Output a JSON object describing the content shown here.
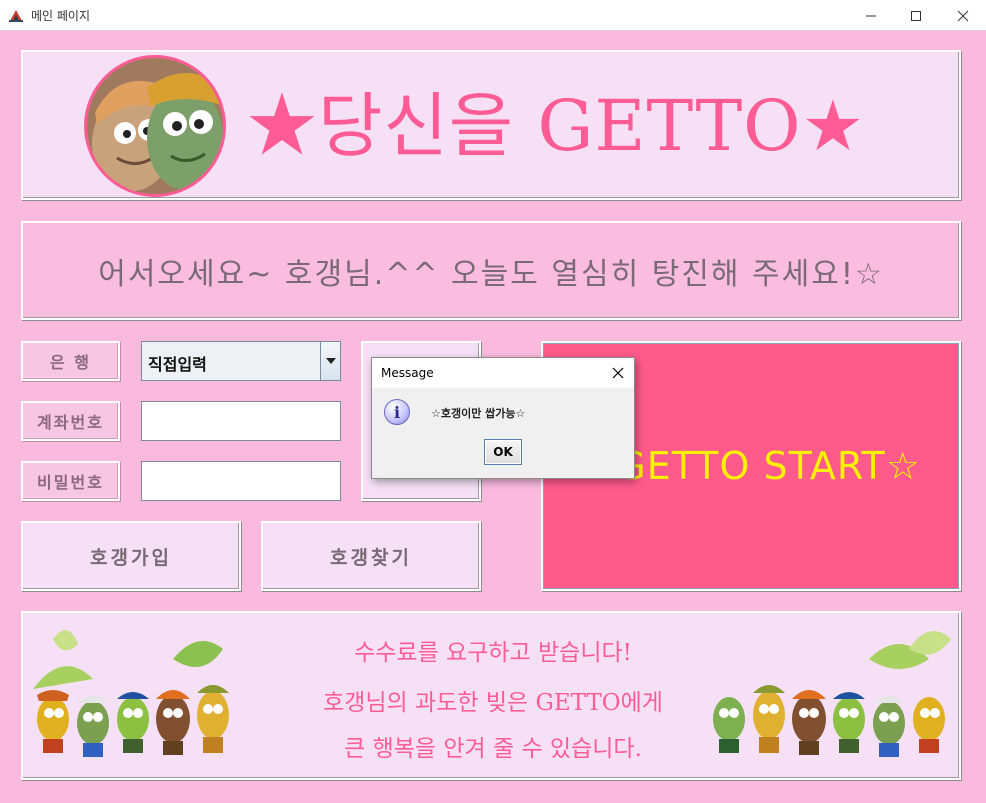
{
  "window": {
    "title": "메인 페이지",
    "icons": {
      "app": "java-app-icon",
      "minimize": "minimize-icon",
      "maximize": "maximize-icon",
      "close": "close-icon"
    }
  },
  "banner": {
    "title": "★당신을 GETTO★",
    "avatar": "avatar"
  },
  "welcome": {
    "text": "어서오세요~ 호갱님.^^ 오늘도 열심히 탕진해 주세요!☆"
  },
  "form": {
    "bank_label": "은  행",
    "bank_value": "직접입력",
    "account_label": "계좌번호",
    "account_value": "",
    "password_label": "비밀번호",
    "password_value": ""
  },
  "buttons": {
    "signup": "호갱가입",
    "find": "호갱찾기",
    "start": "☆GETTO START☆"
  },
  "footer": {
    "line1": "수수료를 요구하고 받습니다!",
    "line2": "호갱님의 과도한 빚은 GETTO에게",
    "line3": "큰 행복을 안겨 줄 수 있습니다."
  },
  "dialog": {
    "title": "Message",
    "message": "☆호갱이만 쌉가능☆",
    "ok": "OK",
    "icon": "info-icon"
  },
  "colors": {
    "background": "#f9bade",
    "panel": "#f5e0f6",
    "accent_pink": "#ff5c95",
    "start_button": "#ff5a8c",
    "start_text": "#fff200"
  }
}
